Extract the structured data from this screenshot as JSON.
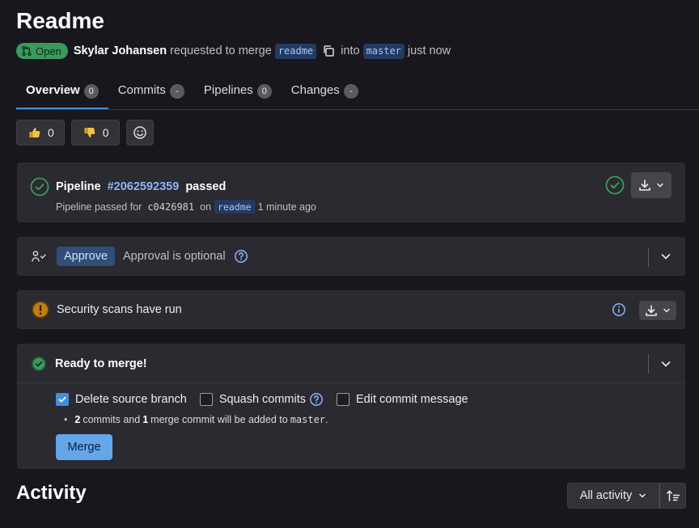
{
  "title": "Readme",
  "meta": {
    "status": "Open",
    "author": "Skylar Johansen",
    "action_text": "requested to merge",
    "source_branch": "readme",
    "into_text": "into",
    "target_branch": "master",
    "time": "just now"
  },
  "tabs": [
    {
      "label": "Overview",
      "count": "0",
      "active": true
    },
    {
      "label": "Commits",
      "count": "-"
    },
    {
      "label": "Pipelines",
      "count": "0"
    },
    {
      "label": "Changes",
      "count": "-"
    }
  ],
  "reactions": {
    "thumbs_up": "0",
    "thumbs_down": "0"
  },
  "pipeline": {
    "label": "Pipeline",
    "id": "#2062592359",
    "status": "passed",
    "sub_prefix": "Pipeline passed for",
    "commit": "c0426981",
    "on_text": "on",
    "branch": "readme",
    "time": "1 minute ago"
  },
  "approval": {
    "button": "Approve",
    "text": "Approval is optional"
  },
  "security": {
    "text": "Security scans have run"
  },
  "merge": {
    "title": "Ready to merge!",
    "options": [
      {
        "label": "Delete source branch",
        "checked": true
      },
      {
        "label": "Squash commits",
        "checked": false
      },
      {
        "label": "Edit commit message",
        "checked": false
      }
    ],
    "note": {
      "commits": "2",
      "mid1": "commits and",
      "merge_commits": "1",
      "mid2": "merge commit will be added to",
      "branch": "master",
      "end": "."
    },
    "button": "Merge"
  },
  "activity": {
    "title": "Activity",
    "filter": "All activity"
  },
  "colors": {
    "background": "#18171d",
    "card": "#2b2a30",
    "accent": "#428fdc",
    "success": "#3a9a5b",
    "warning": "#c17d10"
  }
}
